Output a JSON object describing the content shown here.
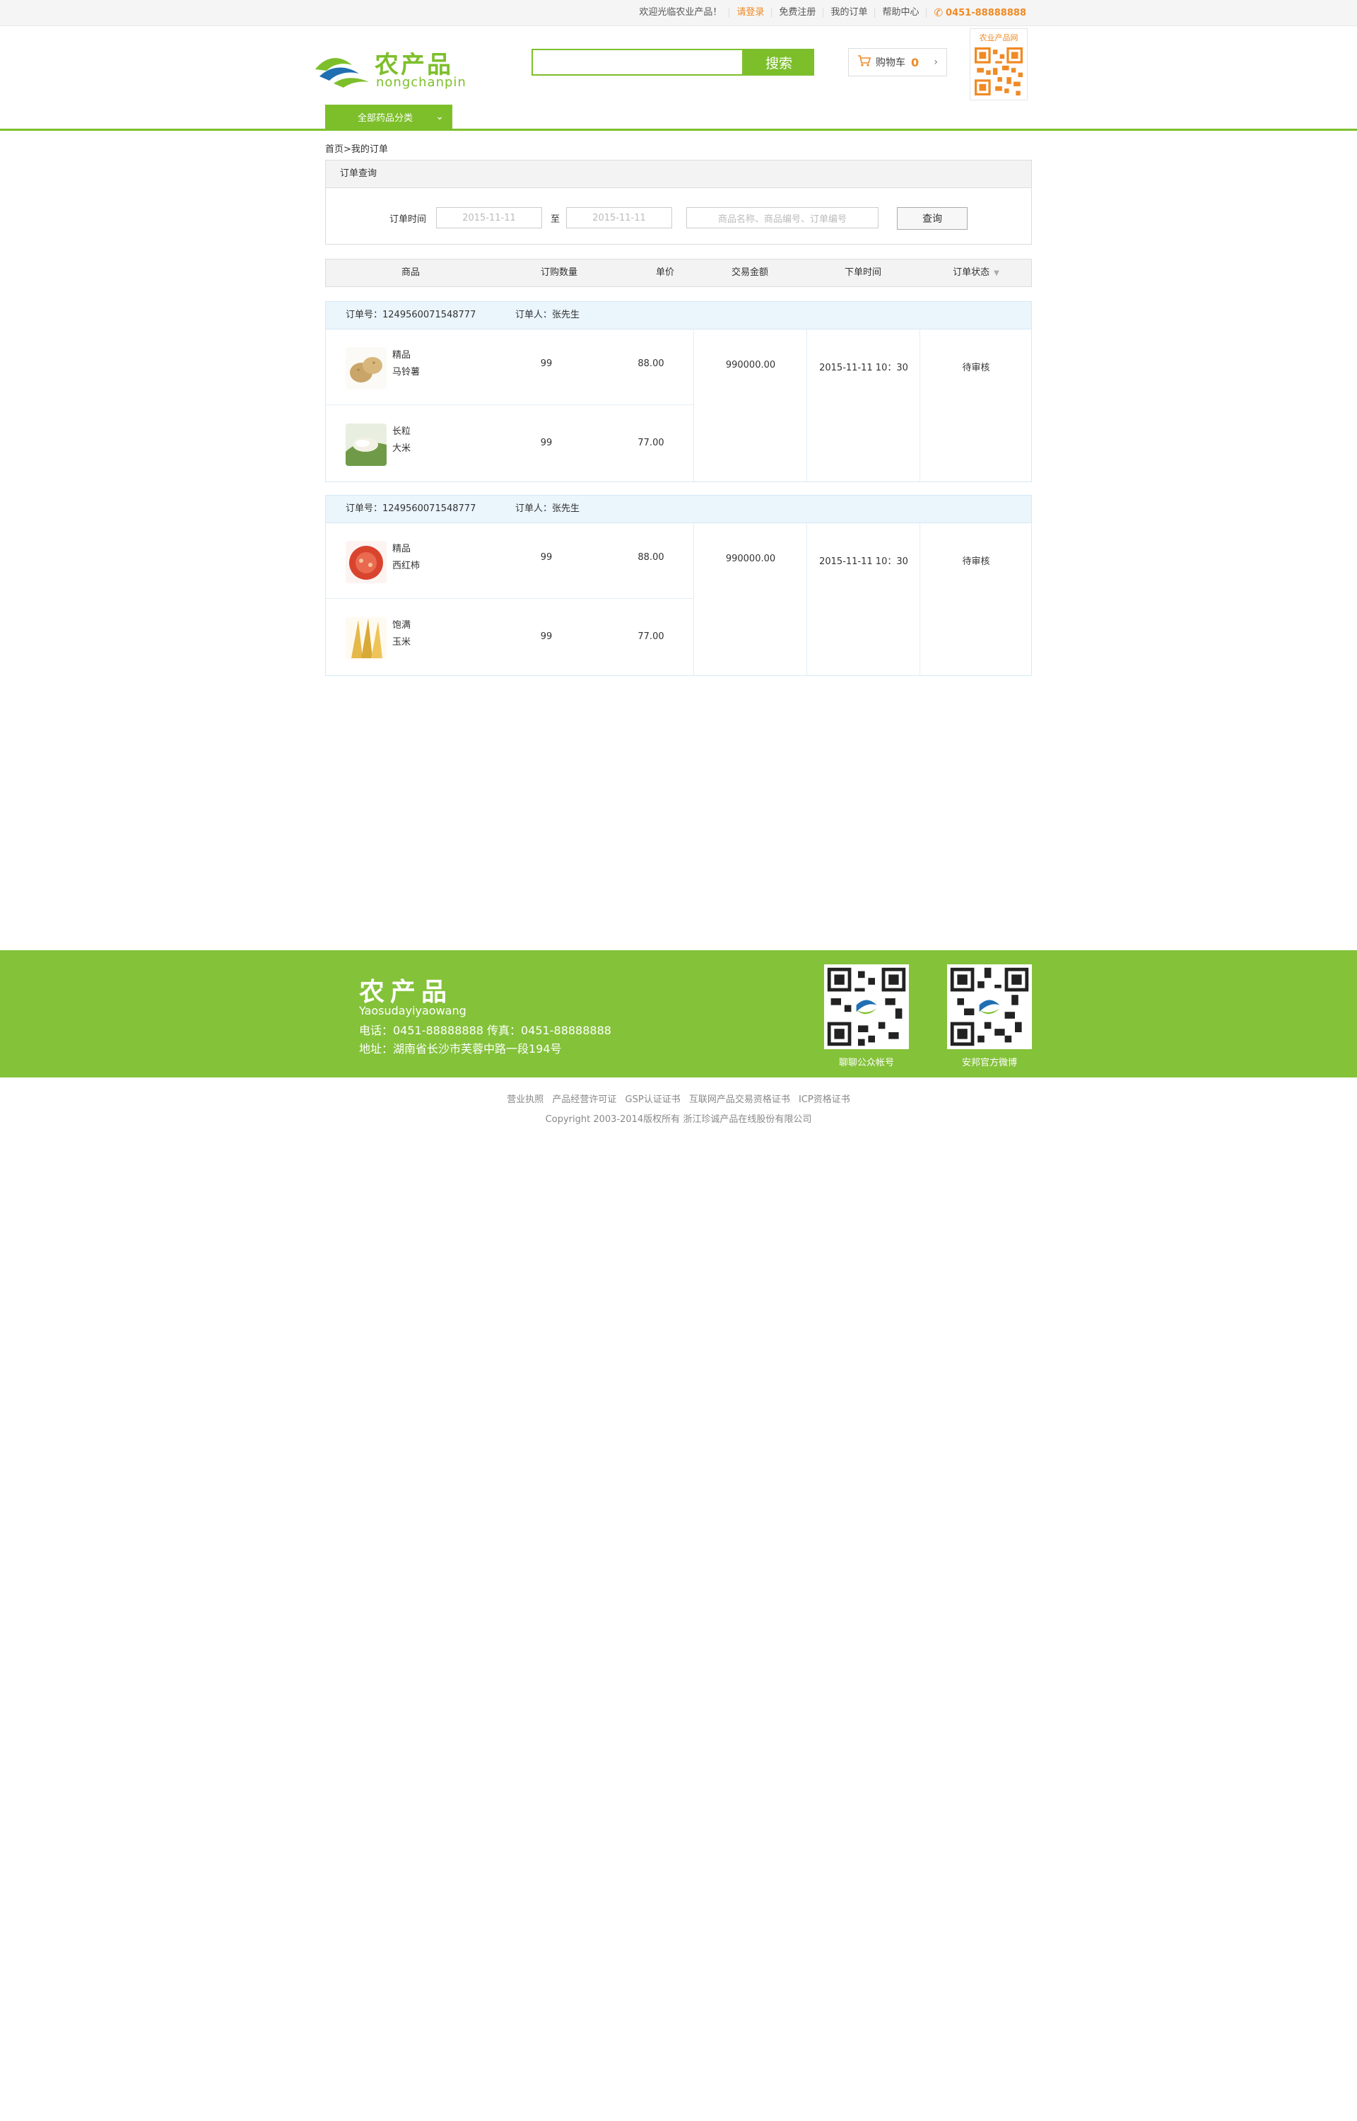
{
  "topbar": {
    "welcome": "欢迎光临农业产品！",
    "login": "请登录",
    "register": "免费注册",
    "my_orders": "我的订单",
    "help": "帮助中心",
    "phone": "0451-88888888"
  },
  "header": {
    "logo_zh": "农产品",
    "logo_en": "nongchanpin",
    "search_button": "搜索",
    "cart_label": "购物车",
    "cart_count": "0",
    "qr_caption": "农业产品网"
  },
  "nav": {
    "category_button": "全部药品分类"
  },
  "breadcrumb": "首页>我的订单",
  "query": {
    "title": "订单查询",
    "time_label": "订单时间",
    "date_from": "2015-11-11",
    "to_label": "至",
    "date_to": "2015-11-11",
    "keyword_placeholder": "商品名称、商品编号、订单编号",
    "button": "查询"
  },
  "table_headers": [
    "商品",
    "订购数量",
    "单价",
    "交易金额",
    "下单时间",
    "订单状态"
  ],
  "orders": [
    {
      "order_no_label": "订单号：1249560071548777",
      "buyer_label": "订单人：张先生",
      "items": [
        {
          "name1": "精品",
          "name2": "马铃薯",
          "qty": "99",
          "price": "88.00"
        },
        {
          "name1": "长粒",
          "name2": "大米",
          "qty": "99",
          "price": "77.00"
        }
      ],
      "amount": "990000.00",
      "time": "2015-11-11 10：30",
      "status": "待审核"
    },
    {
      "order_no_label": "订单号：1249560071548777",
      "buyer_label": "订单人：张先生",
      "items": [
        {
          "name1": "精品",
          "name2": "西红柿",
          "qty": "99",
          "price": "88.00"
        },
        {
          "name1": "饱满",
          "name2": "玉米",
          "qty": "99",
          "price": "77.00"
        }
      ],
      "amount": "990000.00",
      "time": "2015-11-11 10：30",
      "status": "待审核"
    }
  ],
  "footer": {
    "brand": "农产品",
    "sub": "Yaosudayiyaowang",
    "tel": "电话：0451-88888888   传真：0451-88888888",
    "addr": "地址：湖南省长沙市芙蓉中路一段194号",
    "qr1_caption": "聊聊公众帐号",
    "qr2_caption": "安邦官方微博"
  },
  "bottom_links": [
    "营业执照",
    "产品经营许可证",
    "GSP认证证书",
    "互联网产品交易资格证书",
    "ICP资格证书"
  ],
  "copyright": "Copyright 2003-2014版权所有 浙江珍诚产品在线股份有限公司",
  "colors": {
    "brand_green": "#7dbf2b",
    "accent_orange": "#f08a24",
    "footer_green": "#84c23a"
  }
}
